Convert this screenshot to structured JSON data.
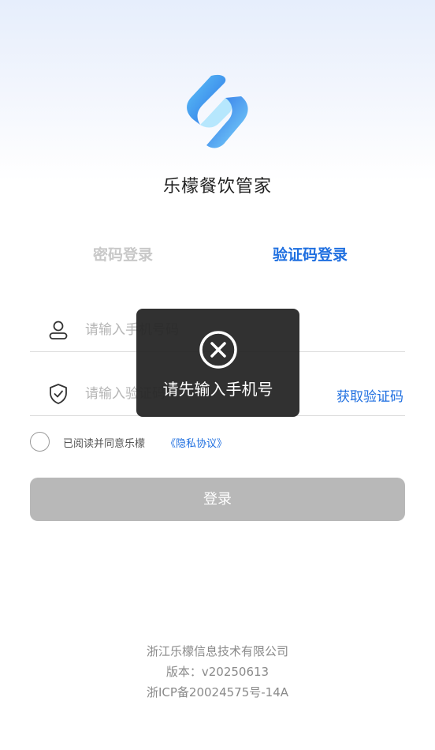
{
  "app": {
    "name": "乐檬餐饮管家",
    "logo_icon": "app-logo-icon"
  },
  "tabs": [
    {
      "label": "密码登录",
      "active": false
    },
    {
      "label": "验证码登录",
      "active": true
    }
  ],
  "form": {
    "phone": {
      "icon": "user-icon",
      "placeholder": "请输入手机号码",
      "value": ""
    },
    "code": {
      "icon": "shield-check-icon",
      "placeholder": "请输入验证码",
      "value": "",
      "get_code_label": "获取验证码"
    }
  },
  "agreement": {
    "checked": false,
    "text": "已阅读并同意乐檬",
    "link": "《隐私协议》"
  },
  "login_button": "登录",
  "footer": {
    "company": "浙江乐檬信息技术有限公司",
    "version": "版本：v20250613",
    "icp": "浙ICP备20024575号-14A"
  },
  "toast": {
    "icon": "close-circle-icon",
    "message": "请先输入手机号"
  },
  "colors": {
    "accent": "#1f6fe0",
    "button_disabled": "#b8b8b8",
    "toast_bg": "#242424"
  }
}
